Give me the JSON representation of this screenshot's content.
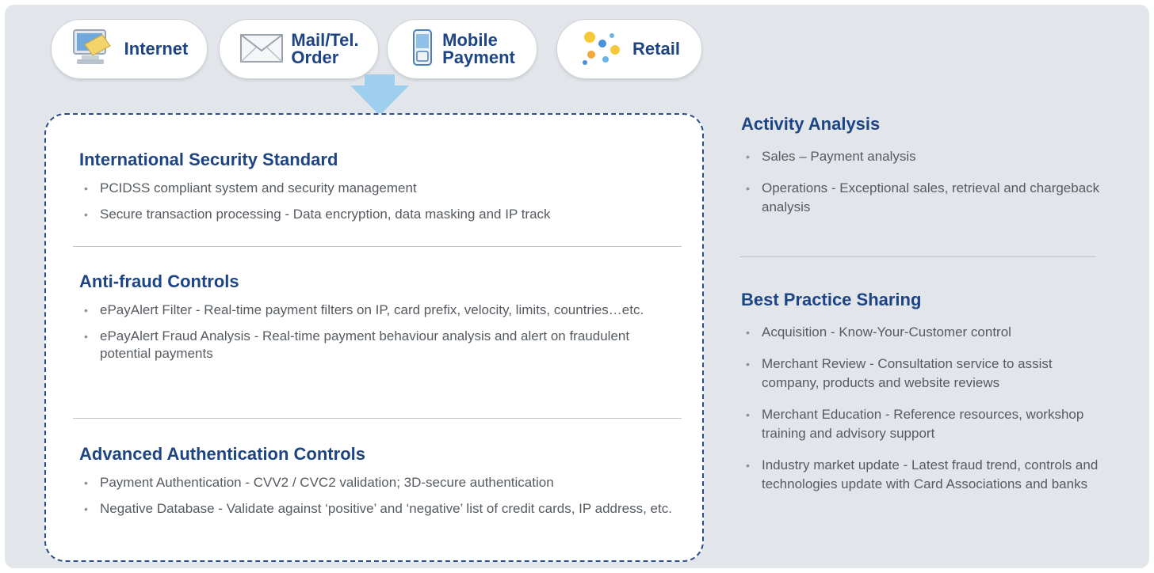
{
  "channels": [
    {
      "label": "Internet",
      "icon": "computer-icon"
    },
    {
      "label": "Mail/Tel.\nOrder",
      "icon": "envelope-icon"
    },
    {
      "label": "Mobile\nPayment",
      "icon": "mobile-phone-icon"
    },
    {
      "label": "Retail",
      "icon": "sparkle-icon"
    }
  ],
  "main": {
    "sections": [
      {
        "title": "International Security Standard",
        "bullets": [
          "PCIDSS compliant system and security management",
          "Secure transaction processing - Data encryption, data masking and IP track"
        ]
      },
      {
        "title": "Anti-fraud Controls",
        "bullets": [
          "ePayAlert Filter - Real-time payment filters on IP, card prefix, velocity, limits, countries…etc.",
          "ePayAlert Fraud Analysis - Real-time payment behaviour analysis and alert on fraudulent potential payments"
        ]
      },
      {
        "title": "Advanced Authentication Controls",
        "bullets": [
          "Payment Authentication - CVV2 / CVC2 validation; 3D-secure authentication",
          "Negative Database - Validate against ‘positive’ and ‘negative’ list of credit cards, IP address, etc."
        ]
      }
    ]
  },
  "side": {
    "sections": [
      {
        "title": "Activity Analysis",
        "bullets": [
          "Sales – Payment analysis",
          "Operations - Exceptional sales, retrieval and chargeback analysis"
        ]
      },
      {
        "title": "Best Practice Sharing",
        "bullets": [
          "Acquisition -  Know-Your-Customer  control",
          "Merchant Review - Consultation service to assist company, products and website reviews",
          "Merchant Education - Reference resources, workshop training and advisory support",
          "Industry market update - Latest fraud trend, controls and technologies update with Card Associations and banks"
        ]
      }
    ]
  },
  "colors": {
    "title_blue": "#1d4483",
    "arrow_blue": "#9fcfee",
    "panel_bg": "#e2e6eb",
    "dash_border": "#2a4f87"
  }
}
